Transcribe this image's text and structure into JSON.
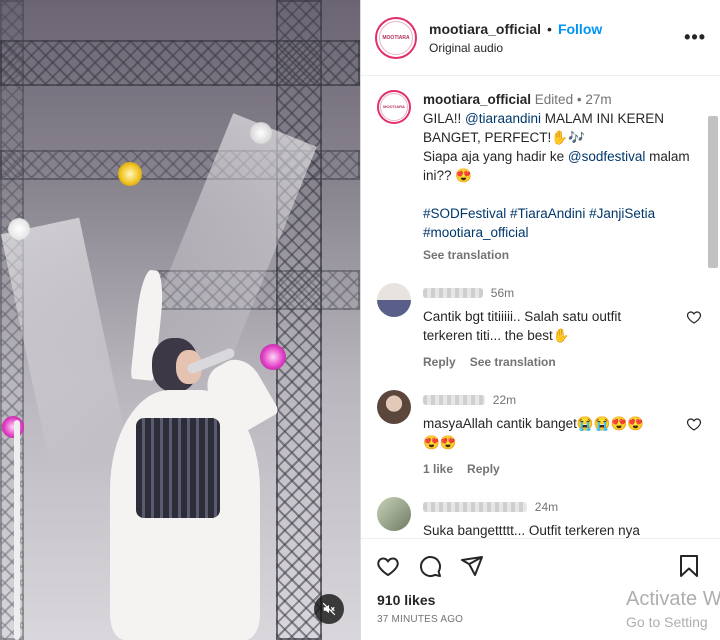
{
  "header": {
    "username": "mootiara_official",
    "separator": "•",
    "follow_label": "Follow",
    "subtitle": "Original audio",
    "avatar_text": "MOOTIARA"
  },
  "caption": {
    "username": "mootiara_official",
    "edited": "Edited",
    "separator": "•",
    "time": "27m",
    "line1_prefix": "GILA!! ",
    "mention1": "@tiaraandini",
    "line1_suffix": " MALAM INI KEREN BANGET, PERFECT!✋🎶",
    "line2_prefix": "Siapa aja yang hadir ke ",
    "mention2": "@sodfestival",
    "line2_suffix": " malam ini?? 😍",
    "hashtags": "#SODFestival #TiaraAndini #JanjiSetia #mootiara_official",
    "see_translation": "See translation"
  },
  "comments": [
    {
      "time": "56m",
      "text": "Cantik bgt titiiiii.. Salah satu outfit terkeren titi... the best✋",
      "reply": "Reply",
      "see_translation": "See translation"
    },
    {
      "time": "22m",
      "text": "masyaAllah cantik banget😭😭😍😍😍😍",
      "likes": "1 like",
      "reply": "Reply"
    },
    {
      "time": "24m",
      "text": "Suka bangettttt... Outfit terkeren nya"
    }
  ],
  "footer": {
    "likes": "910 likes",
    "ago": "37 MINUTES AGO"
  },
  "watermark": {
    "line1": "Activate W",
    "line2": "Go to Setting"
  },
  "colors": {
    "accent": "#0095f6",
    "link": "#00376b",
    "muted": "#737373"
  }
}
